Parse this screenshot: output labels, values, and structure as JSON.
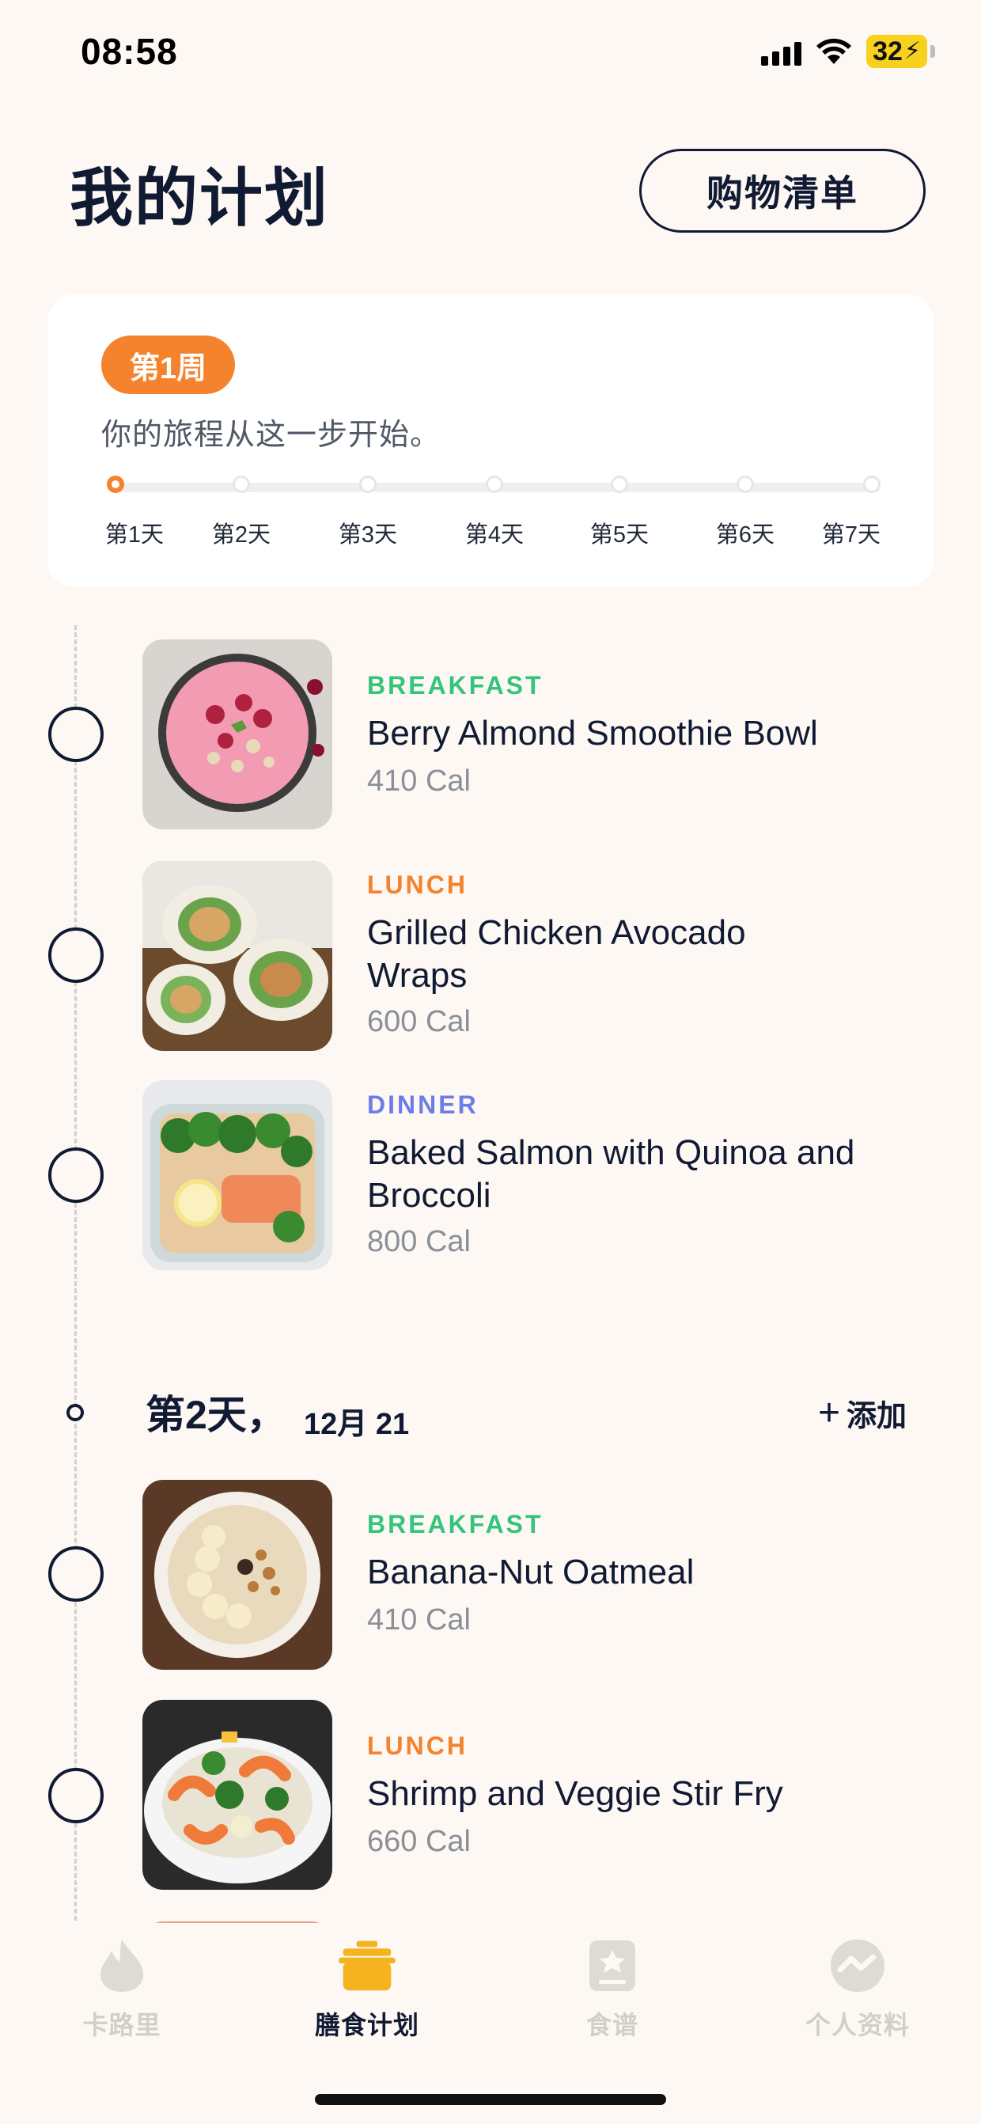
{
  "status_bar": {
    "time": "08:58",
    "battery": "32"
  },
  "header": {
    "title": "我的计划",
    "shopping_button": "购物清单"
  },
  "week_card": {
    "badge": "第1周",
    "subtitle": "你的旅程从这一步开始。",
    "days": [
      "第1天",
      "第2天",
      "第3天",
      "第4天",
      "第5天",
      "第6天",
      "第7天"
    ],
    "active_day": 1
  },
  "day1_meals": [
    {
      "tag": "BREAKFAST",
      "name": "Berry Almond Smoothie Bowl",
      "calories": "410 Cal"
    },
    {
      "tag": "LUNCH",
      "name": "Grilled Chicken Avocado Wraps",
      "calories": "600 Cal"
    },
    {
      "tag": "DINNER",
      "name": "Baked Salmon with Quinoa and Broccoli",
      "calories": "800 Cal"
    }
  ],
  "day2": {
    "title": "第2天，",
    "date": "12月 21",
    "add_label": "添加",
    "meals": [
      {
        "tag": "BREAKFAST",
        "name": "Banana-Nut Oatmeal",
        "calories": "410 Cal"
      },
      {
        "tag": "LUNCH",
        "name": "Shrimp and Veggie Stir Fry",
        "calories": "660 Cal"
      }
    ]
  },
  "tabbar": {
    "tabs": [
      {
        "label": "卡路里",
        "icon": "flame-icon"
      },
      {
        "label": "膳食计划",
        "icon": "pot-icon"
      },
      {
        "label": "食谱",
        "icon": "recipe-book-icon"
      },
      {
        "label": "个人资料",
        "icon": "profile-icon"
      }
    ],
    "active_index": 1
  },
  "colors": {
    "accent": "#f5822c",
    "breakfast": "#35c47c",
    "lunch": "#f5822c",
    "dinner": "#6c7de8",
    "ink": "#111a33",
    "background": "#fdf8f3"
  }
}
